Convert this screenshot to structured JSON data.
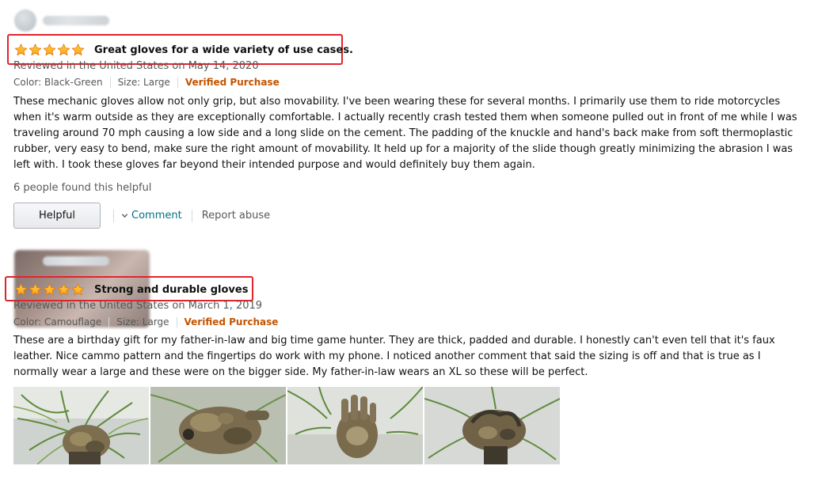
{
  "colors": {
    "star": "#ffa41c",
    "highlight_box": "#e3232b",
    "verified": "#c45500",
    "link": "#007185",
    "muted": "#565959"
  },
  "reviews": [
    {
      "rating": "5 out of 5 stars",
      "title": "Great gloves for a wide variety of use cases.",
      "reviewed_line": "Reviewed in the United States on May 14, 2020",
      "color": "Color: Black-Green",
      "size": "Size: Large",
      "verified": "Verified Purchase",
      "body": "These mechanic gloves allow not only grip, but also movability. I've been wearing these for several months. I primarily use them to ride motorcycles when it's warm outside as they are exceptionally comfortable. I actually recently crash tested them when someone pulled out in front of me while I was traveling around 70 mph causing a low side and a long slide on the cement. The padding of the knuckle and hand's back make from soft thermoplastic rubber, very easy to bend, make sure the right amount of movability. It held up for a majority of the slide though greatly minimizing the abrasion I was left with. I took these gloves far beyond their intended purpose and would definitely buy them again.",
      "helpful_count": "6 people found this helpful",
      "helpful_button": "Helpful",
      "comment_label": "Comment",
      "report_label": "Report abuse"
    },
    {
      "rating": "5 out of 5 stars",
      "title": "Strong and durable gloves",
      "reviewed_line": "Reviewed in the United States on March 1, 2019",
      "color": "Color: Camouflage",
      "size": "Size: Large",
      "verified": "Verified Purchase",
      "body": "These are a birthday gift for my father-in-law and big time game hunter. They are thick, padded and durable. I honestly can't even tell that it's faux leather. Nice cammo pattern and the fingertips do work with my phone. I noticed another comment that said the sizing is off and that is true as I normally wear a large and these were on the bigger side. My father-in-law wears an XL so these will be perfect.",
      "photos": [
        "glove-photo-1",
        "glove-photo-2",
        "glove-photo-3",
        "glove-photo-4"
      ]
    }
  ]
}
